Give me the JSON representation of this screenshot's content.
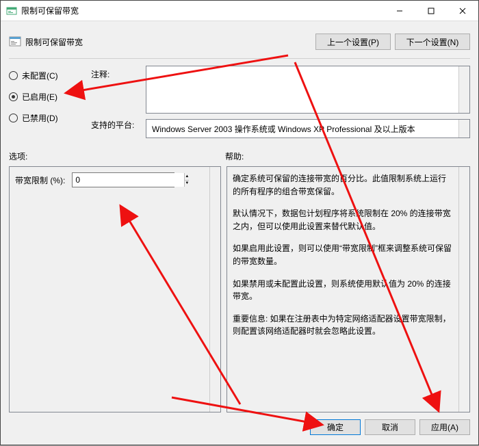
{
  "window": {
    "title": "限制可保留带宽"
  },
  "header": {
    "title": "限制可保留带宽",
    "prev_setting": "上一个设置(P)",
    "next_setting": "下一个设置(N)"
  },
  "radios": {
    "not_configured": "未配置(C)",
    "enabled": "已启用(E)",
    "disabled": "已禁用(D)"
  },
  "labels": {
    "comment": "注释:",
    "supported": "支持的平台:",
    "options": "选项:",
    "help": "帮助:"
  },
  "supported_text": "Windows Server 2003 操作系统或 Windows XP Professional 及以上版本",
  "option": {
    "bandwidth_limit_label": "带宽限制 (%):",
    "bandwidth_limit_value": "0"
  },
  "help": {
    "p1": "确定系统可保留的连接带宽的百分比。此值限制系统上运行的所有程序的组合带宽保留。",
    "p2": "默认情况下，数据包计划程序将系统限制在 20% 的连接带宽之内，但可以使用此设置来替代默认值。",
    "p3": "如果启用此设置，则可以使用“带宽限制”框来调整系统可保留的带宽数量。",
    "p4": "如果禁用或未配置此设置，则系统使用默认值为 20% 的连接带宽。",
    "p5": "重要信息: 如果在注册表中为特定网络适配器设置带宽限制，则配置该网络适配器时就会忽略此设置。"
  },
  "buttons": {
    "ok": "确定",
    "cancel": "取消",
    "apply": "应用(A)"
  }
}
